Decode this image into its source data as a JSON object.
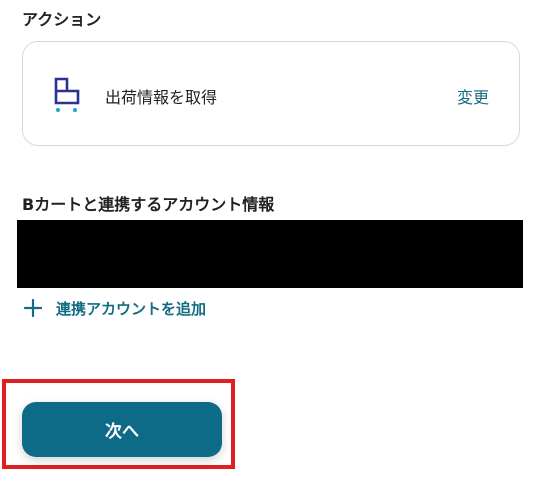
{
  "action_section": {
    "label": "アクション",
    "action_name": "出荷情報を取得",
    "change_label": "変更",
    "icon": "b-cart-icon",
    "icon_color": "#2d3190",
    "icon_accent_color": "#1fa2d8"
  },
  "account_section": {
    "label": "Bカートと連携するアカウント情報",
    "redacted_value": "",
    "add_account_label": "連携アカウントを追加",
    "add_icon": "plus-icon"
  },
  "footer": {
    "next_label": "次へ"
  },
  "colors": {
    "accent": "#136c83",
    "button_bg": "#0d6b87",
    "highlight": "#e02020"
  }
}
